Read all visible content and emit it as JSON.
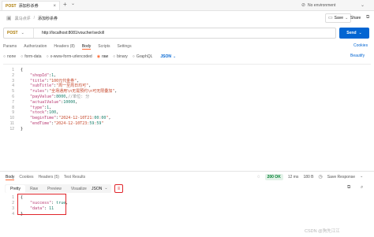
{
  "tab_bar": {
    "tab_method": "POST",
    "tab_title": "添加秒杀券",
    "environment": "No environment"
  },
  "breadcrumb": {
    "collection": "黑马点评",
    "separator": "/",
    "request_name": "添加秒杀券"
  },
  "header_actions": {
    "save": "Save",
    "share": "Share"
  },
  "url_bar": {
    "method": "POST",
    "url": "http://localhost:8081/voucher/seckill",
    "send": "Send"
  },
  "request_tabs": [
    "Params",
    "Authorization",
    "Headers (8)",
    "Body",
    "Scripts",
    "Settings"
  ],
  "request_tabs_active": "Body",
  "cookies_link": "Cookies",
  "body_types": [
    "none",
    "form-data",
    "x-www-form-urlencoded",
    "raw",
    "binary",
    "GraphQL"
  ],
  "body_type_selected": "raw",
  "format_select": "JSON",
  "beautify": "Beautify",
  "request_code": {
    "line_numbers": [
      "1",
      "2",
      "3",
      "4",
      "5",
      "6",
      "7",
      "8",
      "9",
      "10",
      "11",
      "12"
    ],
    "lines": [
      "{",
      "    \"shopId\":1,",
      "    \"title\":\"100元代金券\",",
      "    \"subTitle\":\"周一至周日均可\",",
      "    \"rules\":\"全场通用\\n无需预约\\n可无限叠加\",",
      "    \"payValue\":8000,//单位: 分",
      "    \"actualValue\":10000,",
      "    \"type\":1,",
      "    \"stock\":100,",
      "    \"beginTime\":\"2024-12-10T21:00:00\",",
      "    \"endTime\":\"2024-12-10T23:59:59\"",
      "}"
    ]
  },
  "response_tabs": [
    "Body",
    "Cookies",
    "Headers (5)",
    "Test Results"
  ],
  "response_tabs_active": "Body",
  "response_status": {
    "code": "200 OK",
    "time": "12 ms",
    "size": "180 B",
    "save_response": "Save Response"
  },
  "response_view_tabs": [
    "Pretty",
    "Raw",
    "Preview",
    "Visualize"
  ],
  "response_view_active": "Pretty",
  "response_format": "JSON",
  "response_code": {
    "line_numbers": [
      "1",
      "2",
      "3",
      "4"
    ],
    "lines": [
      "{",
      "    \"success\": true,",
      "    \"data\": 11",
      "}"
    ]
  },
  "watermark": "CSDN @狗先江江",
  "colors": {
    "send": "#0265d2",
    "post": "#ad7a03",
    "highlight_box": "#e0252b",
    "status_ok": "#007f31",
    "active_tab": "#ff6c37"
  }
}
